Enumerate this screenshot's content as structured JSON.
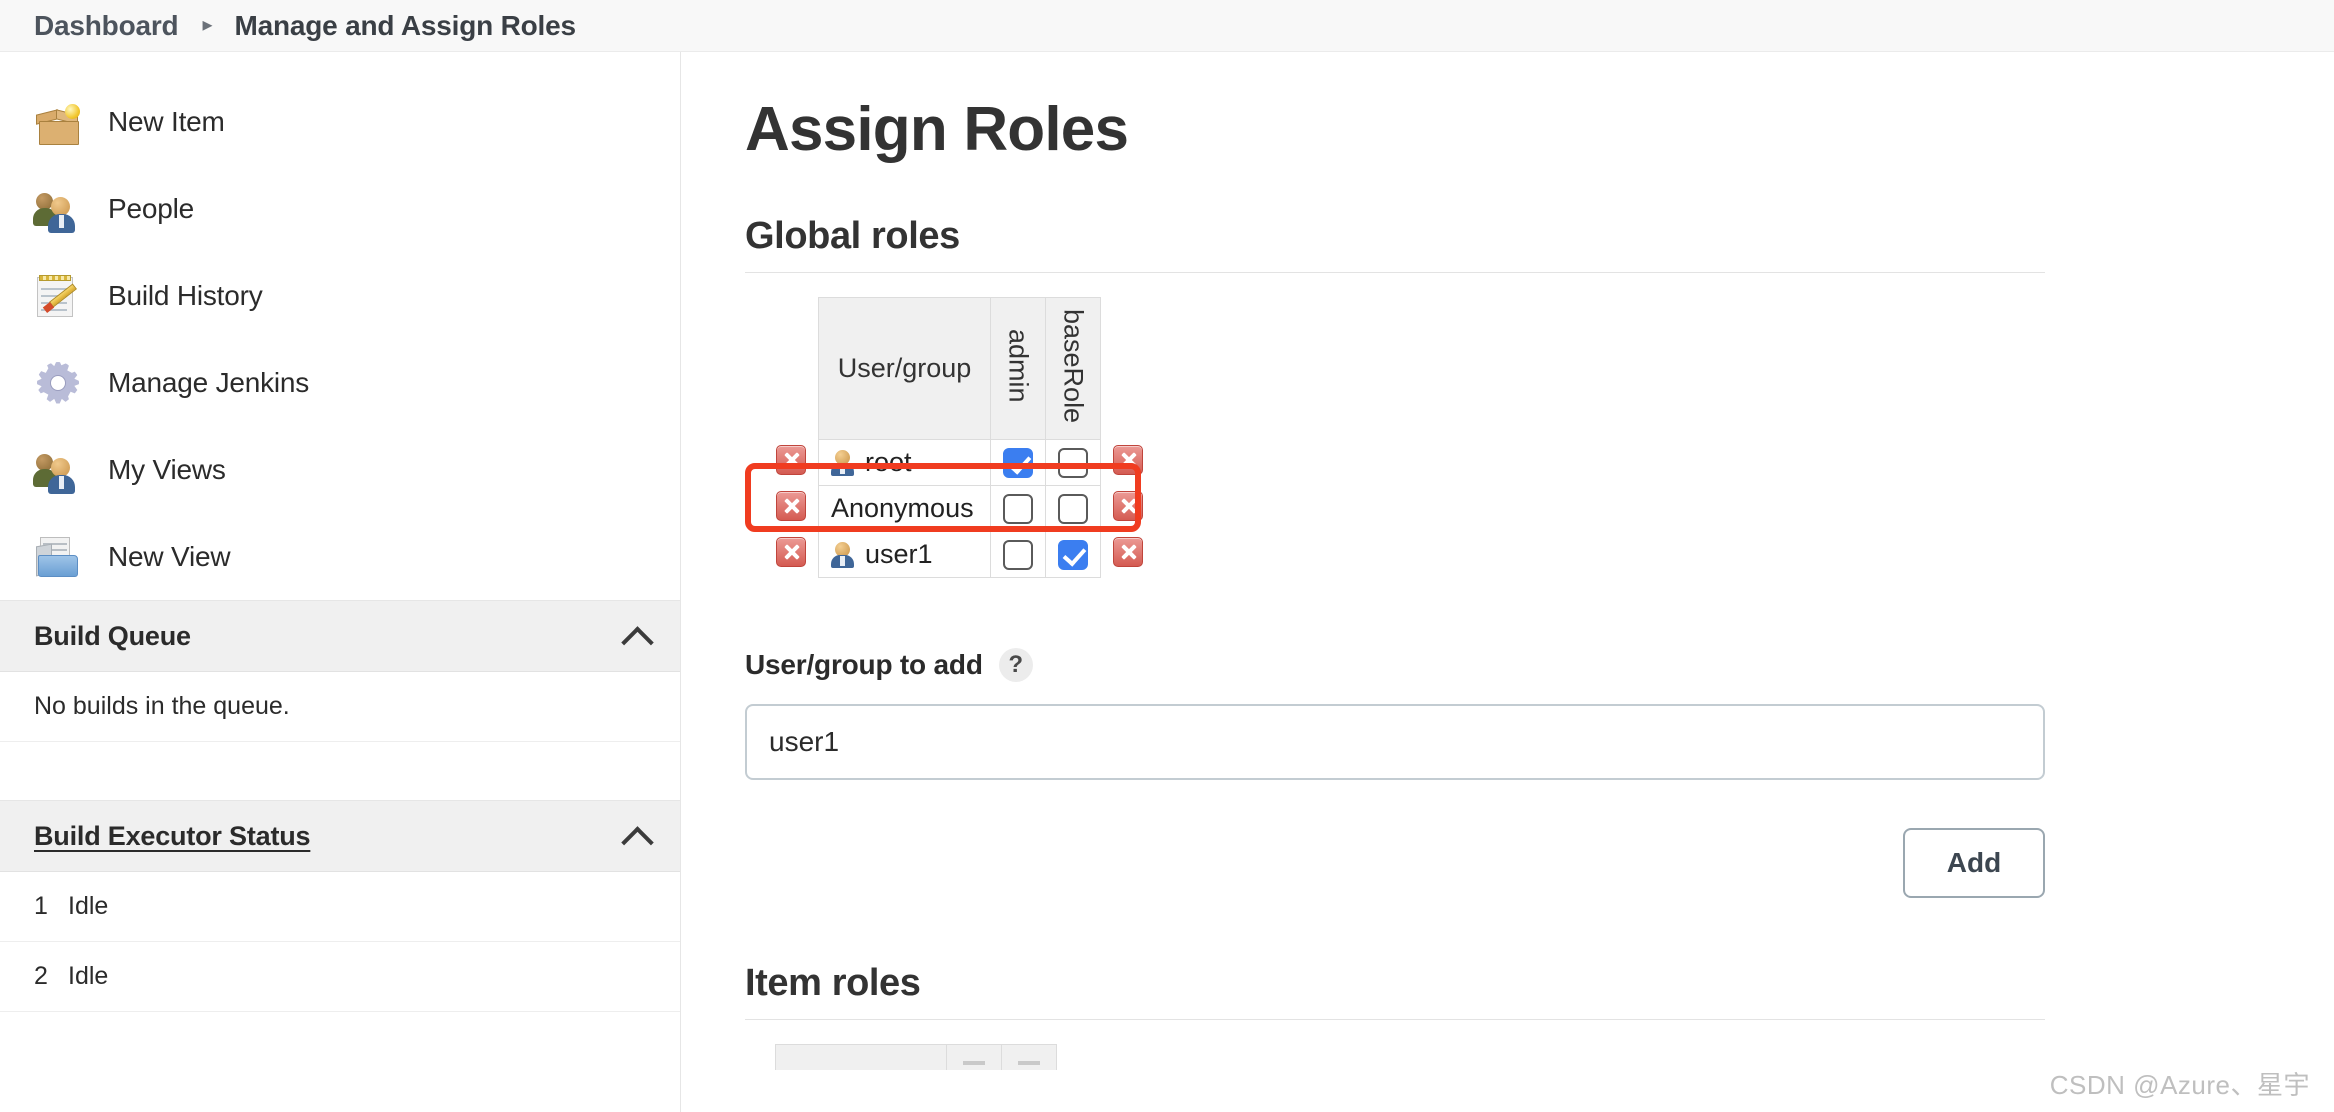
{
  "breadcrumb": {
    "items": [
      {
        "label": "Dashboard"
      },
      {
        "label": "Manage and Assign Roles"
      }
    ],
    "separator": "▸"
  },
  "sidebar": {
    "items": [
      {
        "label": "New Item",
        "icon": "new-item-box-icon"
      },
      {
        "label": "People",
        "icon": "people-icon"
      },
      {
        "label": "Build History",
        "icon": "notepad-pencil-icon"
      },
      {
        "label": "Manage Jenkins",
        "icon": "gear-icon"
      },
      {
        "label": "My Views",
        "icon": "people-icon"
      },
      {
        "label": "New View",
        "icon": "folder-icon"
      }
    ],
    "build_queue": {
      "title": "Build Queue",
      "collapse_icon": "chevron-up-icon",
      "empty_text": "No builds in the queue."
    },
    "build_executor_status": {
      "title": "Build Executor Status",
      "collapse_icon": "chevron-up-icon",
      "executors": [
        {
          "number": "1",
          "status": "Idle"
        },
        {
          "number": "2",
          "status": "Idle"
        }
      ]
    }
  },
  "main": {
    "page_title": "Assign Roles",
    "global_roles": {
      "heading": "Global roles",
      "columns": [
        "User/group",
        "admin",
        "baseRole"
      ],
      "rows": [
        {
          "name": "root",
          "has_user_icon": true,
          "admin": true,
          "baseRole": false,
          "delete_icon": "delete-x-icon",
          "highlighted": false
        },
        {
          "name": "Anonymous",
          "has_user_icon": false,
          "admin": false,
          "baseRole": false,
          "delete_icon": "delete-x-icon",
          "highlighted": false
        },
        {
          "name": "user1",
          "has_user_icon": true,
          "admin": false,
          "baseRole": true,
          "delete_icon": "delete-x-icon",
          "highlighted": true
        }
      ]
    },
    "add_form": {
      "label": "User/group to add",
      "help_glyph": "?",
      "input_value": "user1",
      "input_placeholder": "",
      "add_label": "Add"
    },
    "item_roles": {
      "heading": "Item roles"
    }
  },
  "watermark": "CSDN @Azure、星宇",
  "colors": {
    "checkbox_checked": "#3b7ef0",
    "delete_red": "#d45b52",
    "highlight_red": "#f03c20",
    "breadcrumb_text": "#4d545d",
    "panel_bg": "#f0f0f0"
  }
}
